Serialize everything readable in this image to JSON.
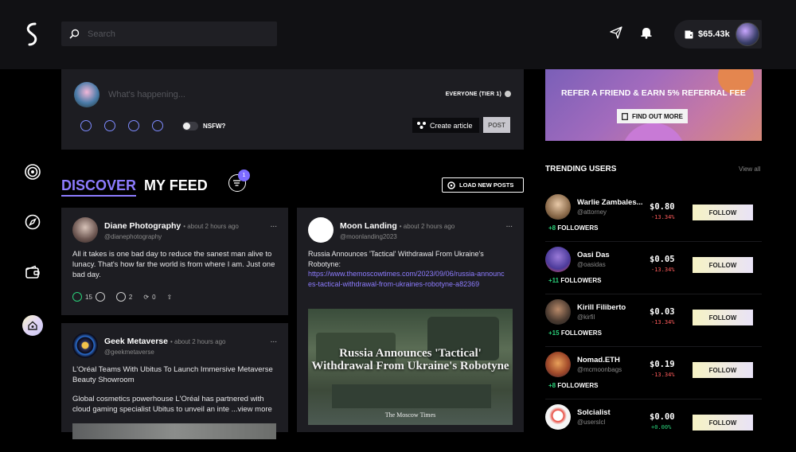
{
  "search": {
    "placeholder": "Search"
  },
  "wallet": {
    "balance": "$65.43k"
  },
  "composer": {
    "placeholder": "What's happening...",
    "audience": "EVERYONE (TIER 1)",
    "nsfw_label": "NSFW?",
    "create_article_label": "Create article",
    "post_label": "POST"
  },
  "feed": {
    "tabs": [
      {
        "label": "DISCOVER"
      },
      {
        "label": "MY FEED"
      }
    ],
    "filter_badge": "1",
    "load_new_label": "LOAD NEW POSTS"
  },
  "posts": [
    {
      "name": "Diane Photography",
      "time": "• about 2 hours ago",
      "handle": "@dianephotography",
      "more": "...",
      "text": "All it takes is one bad day to reduce the sanest man alive to lunacy. That's how far the world is from where I am. Just one bad day.",
      "likes": "15",
      "comments": "2",
      "reposts": "0"
    },
    {
      "name": "Moon Landing",
      "time": "• about 2 hours ago",
      "handle": "@moonlanding2023",
      "more": "...",
      "text": "Russia Announces 'Tactical' Withdrawal From Ukraine's Robotyne:",
      "link": "https://www.themoscowtimes.com/2023/09/06/russia-announces-tactical-withdrawal-from-ukraines-robotyne-a82369",
      "image_headline": "Russia Announces 'Tactical' Withdrawal From Ukraine's Robotyne",
      "image_source": "The Moscow Times"
    },
    {
      "name": "Geek Metaverse",
      "time": "• about 2 hours ago",
      "handle": "@geekmetaverse",
      "more": "...",
      "title": "L'Oréal Teams With Ubitus To Launch Immersive Metaverse Beauty Showroom",
      "text": "Global cosmetics powerhouse L'Oréal has partnered with cloud gaming specialist Ubitus to unveil an inte",
      "view_more": "...view more"
    }
  ],
  "referral": {
    "text": "REFER A FRIEND & EARN 5% REFERRAL FEE",
    "button": "FIND OUT MORE"
  },
  "trending": {
    "title": "TRENDING USERS",
    "view_all": "View all",
    "users": [
      {
        "name": "Warlie Zambales...",
        "handle": "@attorney",
        "followers_new": "+8",
        "followers_label": "FOLLOWERS",
        "price": "$0.80",
        "change": "-13.34%",
        "follow": "FOLLOW"
      },
      {
        "name": "Oasi Das",
        "handle": "@oasidas",
        "followers_new": "+11",
        "followers_label": "FOLLOWERS",
        "price": "$0.05",
        "change": "-13.34%",
        "follow": "FOLLOW"
      },
      {
        "name": "Kirill Filiberto",
        "handle": "@kirfil",
        "followers_new": "+15",
        "followers_label": "FOLLOWERS",
        "price": "$0.03",
        "change": "-13.34%",
        "follow": "FOLLOW"
      },
      {
        "name": "Nomad.ETH",
        "handle": "@mcmoonbags",
        "followers_new": "+8",
        "followers_label": "FOLLOWERS",
        "price": "$0.19",
        "change": "-13.34%",
        "follow": "FOLLOW"
      },
      {
        "name": "Solcialist",
        "handle": "@userslcl",
        "followers_new": "",
        "followers_label": "",
        "price": "$0.00",
        "change": "+0.00%",
        "follow": "FOLLOW"
      }
    ]
  }
}
